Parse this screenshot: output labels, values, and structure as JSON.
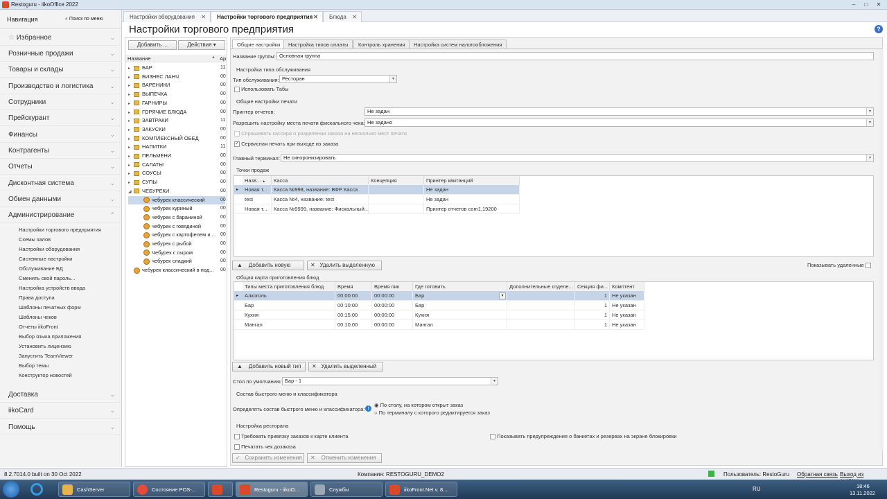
{
  "window": {
    "title": "Restoguru - iikoOffice 2022"
  },
  "nav": {
    "title": "Навигация",
    "search": "Поиск по меню",
    "sections": [
      "Избранное",
      "Розничные продажи",
      "Товары и склады",
      "Производство и логистика",
      "Сотрудники",
      "Прейскурант",
      "Финансы",
      "Контрагенты",
      "Отчеты",
      "Дисконтная система",
      "Обмен данными",
      "Администрирование"
    ],
    "admin_items": [
      "Настройки торгового предприятия",
      "Схемы залов",
      "Настройки оборудования",
      "Системные настройки",
      "Обслуживание БД",
      "Сменить свой пароль...",
      "Настройка устройств ввода",
      "Права доступа",
      "Шаблоны печатных форм",
      "Шаблоны чеков",
      "Отчеты iikoFront",
      "Выбор языка приложения",
      "Установить лицензию",
      "Запустить TeamViewer",
      "Выбор темы",
      "Конструктор новостей"
    ],
    "bottom_sections": [
      "Доставка",
      "iikoCard",
      "Помощь"
    ]
  },
  "doc_tabs": [
    "Настройки оборудования",
    "Настройки торгового предприятия",
    "Блюда"
  ],
  "page_title": "Настройки торгового предприятия",
  "tree": {
    "add": "Добавить ...",
    "actions": "Действия",
    "col_name": "Название",
    "col_ar": "Ар",
    "items": [
      {
        "name": "БАР",
        "n": "11",
        "kind": "folder"
      },
      {
        "name": "БИЗНЕС ЛАНЧ",
        "n": "00",
        "kind": "folder"
      },
      {
        "name": "ВАРЕНИКИ",
        "n": "00",
        "kind": "folder"
      },
      {
        "name": "ВЫПЕЧКА",
        "n": "00",
        "kind": "folder"
      },
      {
        "name": "ГАРНИРЫ",
        "n": "00",
        "kind": "folder"
      },
      {
        "name": "ГОРЯЧИЕ БЛЮДА",
        "n": "00",
        "kind": "folder"
      },
      {
        "name": "ЗАВТРАКИ",
        "n": "11",
        "kind": "folder"
      },
      {
        "name": "ЗАКУСКИ",
        "n": "00",
        "kind": "folder"
      },
      {
        "name": "КОМПЛЕКСНЫЙ ОБЕД",
        "n": "00",
        "kind": "folder"
      },
      {
        "name": "НАПИТКИ",
        "n": "11",
        "kind": "folder"
      },
      {
        "name": "ПЕЛЬМЕНИ",
        "n": "00",
        "kind": "folder"
      },
      {
        "name": "САЛАТЫ",
        "n": "00",
        "kind": "folder"
      },
      {
        "name": "СОУСЫ",
        "n": "00",
        "kind": "folder"
      },
      {
        "name": "СУПЫ",
        "n": "00",
        "kind": "folder"
      },
      {
        "name": "ЧЕБУРЕКИ",
        "n": "00",
        "kind": "folder-open"
      },
      {
        "name": "чебурек классический",
        "n": "00",
        "kind": "dish-sel"
      },
      {
        "name": "чебурек куриный",
        "n": "00",
        "kind": "dish"
      },
      {
        "name": "чебурек с бараниной",
        "n": "00",
        "kind": "dish"
      },
      {
        "name": "чебурек с говядиной",
        "n": "00",
        "kind": "dish"
      },
      {
        "name": "чебурек с картофелем и ...",
        "n": "00",
        "kind": "dish"
      },
      {
        "name": "чебурек с рыбой",
        "n": "00",
        "kind": "dish"
      },
      {
        "name": "Чебурек с сыром",
        "n": "00",
        "kind": "dish"
      },
      {
        "name": "чебурек сладкий",
        "n": "00",
        "kind": "dish"
      },
      {
        "name": "чебурек классический в под...",
        "n": "00",
        "kind": "dish-root"
      }
    ]
  },
  "content_tabs": [
    "Общие настройки",
    "Настройка типов оплаты",
    "Контроль хранения",
    "Настройка систем налогообложения"
  ],
  "general": {
    "group_label": "Название группы:",
    "group_value": "Основная группа",
    "service_header": "Настройка типа обслуживания",
    "service_label": "Тип обслуживания:",
    "service_value": "Ресторан",
    "use_tabs": "Использовать Табы",
    "print_header": "Общие настройки печати",
    "report_printer_label": "Принтер отчетов:",
    "report_printer_value": "Не задан",
    "fiscal_label": "Разрешить настройку места печати фискального чека:",
    "fiscal_value": "Не задано",
    "ask_cashier": "Спрашивать кассира о разделении заказа на несколько мест печати",
    "service_print": "Сервисная печать при выходе из заказа",
    "main_terminal_label": "Главный терминал:",
    "main_terminal_value": "Не синхронизировать"
  },
  "pos": {
    "header": "Точки продаж",
    "columns": [
      "Назв...",
      "Касса",
      "Концепция",
      "Принтер квитанций"
    ],
    "rows": [
      [
        "Новая т...",
        "Касса №998, название: ВФР Касса",
        "",
        "Не задан"
      ],
      [
        "test",
        "Касса №4, название: test",
        "",
        "Не задан"
      ],
      [
        "Новая т...",
        "Касса №9999, название: Фискальный...",
        "",
        "Принтер отчетов com1,19200"
      ]
    ],
    "add": "Добавить новую",
    "delete": "Удалить выделенную",
    "show_deleted": "Показывать удаленные"
  },
  "prep": {
    "header": "Общая карта приготовления блюд",
    "columns": [
      "Типы места приготовления блюд",
      "Время",
      "Время пик",
      "Где готовить",
      "Дополнительные отделе...",
      "Секция фи...",
      "Комптент"
    ],
    "rows": [
      [
        "Алкоголь",
        "00:00:00",
        "00:00:00",
        "Бар",
        "",
        "1",
        "Не указан"
      ],
      [
        "Бар",
        "00:10:00",
        "00:00:00",
        "Бар",
        "",
        "1",
        "Не указан"
      ],
      [
        "Кухня",
        "00:15:00",
        "00:00:00",
        "Кухня",
        "",
        "1",
        "Не указан"
      ],
      [
        "Мангал",
        "00:10:00",
        "00:00:00",
        "Мангал",
        "",
        "1",
        "Не указан"
      ]
    ],
    "add": "Добавить новый тип",
    "delete": "Удалить выделенный"
  },
  "table_default": {
    "label": "Стол по умолчанию:",
    "value": "Бар - 1"
  },
  "quick_menu": {
    "header": "Состав быстрого меню и классификатора",
    "label": "Определять состав быстрого меню и классификатора:",
    "opt1": "По столу, на котором открыт заказ",
    "opt2": "По терминалу с которого редактируется заказ"
  },
  "restaurant": {
    "header": "Настройка ресторана",
    "opt1": "Требовать привязку заказов к карте клиента",
    "opt2": "Печатать чек дозаказа",
    "opt3": "Показывать предупреждения о банкетах и резервах на экране блокировки"
  },
  "actions": {
    "save": "Сохранить изменения",
    "cancel": "Отменить изменения"
  },
  "status": {
    "build": "8.2.7014.0 built on 30 Oct 2022",
    "company": "Компания: RESTOGURU_DEMO2",
    "user": "Пользователь: RestoGuru",
    "feedback": "Обратная связь",
    "exit": "Выход из системы"
  },
  "taskbar": {
    "items": [
      "CashServer",
      "Состояние POS-...",
      "",
      "Restoguru - iikoO...",
      "Службы",
      "iikoFront.Net v. 8...."
    ],
    "lang": "RU",
    "time": "18:46",
    "date": "13.11.2022"
  }
}
